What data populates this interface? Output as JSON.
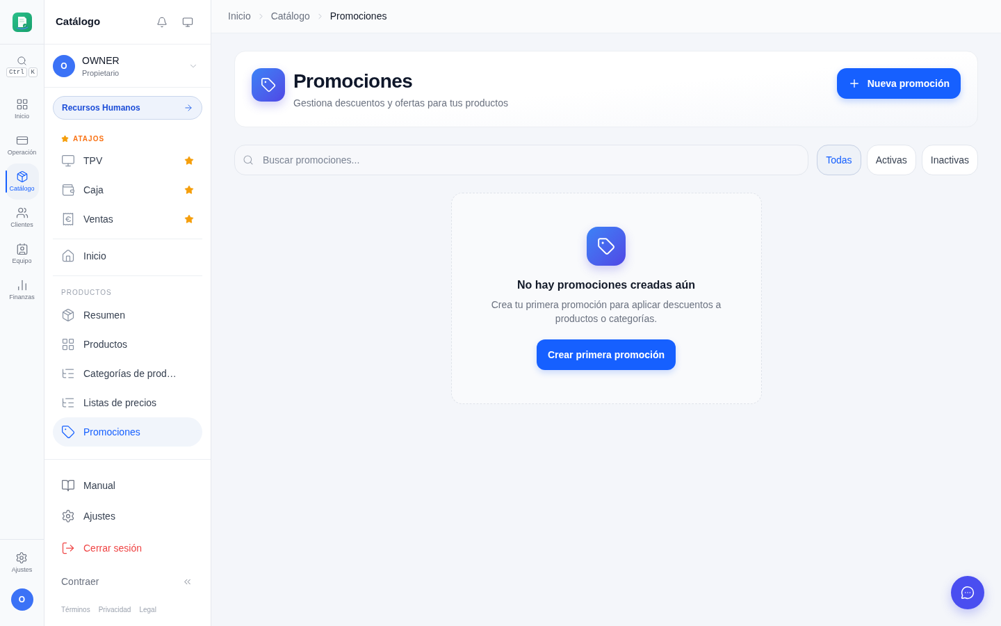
{
  "rail": {
    "search": {
      "keys": [
        "Ctrl",
        "K"
      ]
    },
    "items": [
      {
        "label": "Inicio",
        "selected": false
      },
      {
        "label": "Operación",
        "selected": false
      },
      {
        "label": "Catálogo",
        "selected": true
      },
      {
        "label": "Clientes",
        "selected": false
      },
      {
        "label": "Equipo",
        "selected": false
      },
      {
        "label": "Finanzas",
        "selected": false
      }
    ],
    "settings": {
      "label": "Ajustes"
    },
    "avatar": {
      "initial": "O"
    }
  },
  "sidebar": {
    "title": "Catálogo",
    "user": {
      "initial": "O",
      "name": "OWNER",
      "role": "Propietario"
    },
    "module_link": {
      "label": "Recursos Humanos"
    },
    "shortcuts": {
      "label": "ATAJOS",
      "items": [
        {
          "label": "TPV",
          "starred": true,
          "selected": false
        },
        {
          "label": "Caja",
          "starred": true,
          "selected": false
        },
        {
          "label": "Ventas",
          "starred": true,
          "selected": false
        }
      ]
    },
    "home": {
      "label": "Inicio",
      "selected": false
    },
    "sections": [
      {
        "label": "PRODUCTOS",
        "items": [
          {
            "label": "Resumen",
            "selected": false
          },
          {
            "label": "Productos",
            "selected": false
          },
          {
            "label": "Categorías de prod…",
            "selected": false
          },
          {
            "label": "Listas de precios",
            "selected": false
          },
          {
            "label": "Promociones",
            "selected": true
          }
        ]
      }
    ],
    "bottom_items": [
      {
        "kind": "link",
        "label": "Manual"
      },
      {
        "kind": "link",
        "label": "Ajustes"
      },
      {
        "kind": "danger",
        "label": "Cerrar sesión"
      }
    ],
    "collapse": {
      "label": "Contraer"
    },
    "footer_links": [
      "Términos",
      "Privacidad",
      "Legal"
    ]
  },
  "breadcrumb": [
    {
      "label": "Inicio",
      "current": false
    },
    {
      "label": "Catálogo",
      "current": false
    },
    {
      "label": "Promociones",
      "current": true
    }
  ],
  "header": {
    "title": "Promociones",
    "subtitle": "Gestiona descuentos y ofertas para tus productos",
    "action": "Nueva promoción"
  },
  "search": {
    "placeholder": "Buscar promociones..."
  },
  "filters": [
    {
      "label": "Todas",
      "selected": true
    },
    {
      "label": "Activas",
      "selected": false
    },
    {
      "label": "Inactivas",
      "selected": false
    }
  ],
  "empty_state": {
    "title": "No hay promociones creadas aún",
    "description": "Crea tu primera promoción para aplicar descuentos a productos o categorías.",
    "action": "Crear primera promoción"
  }
}
